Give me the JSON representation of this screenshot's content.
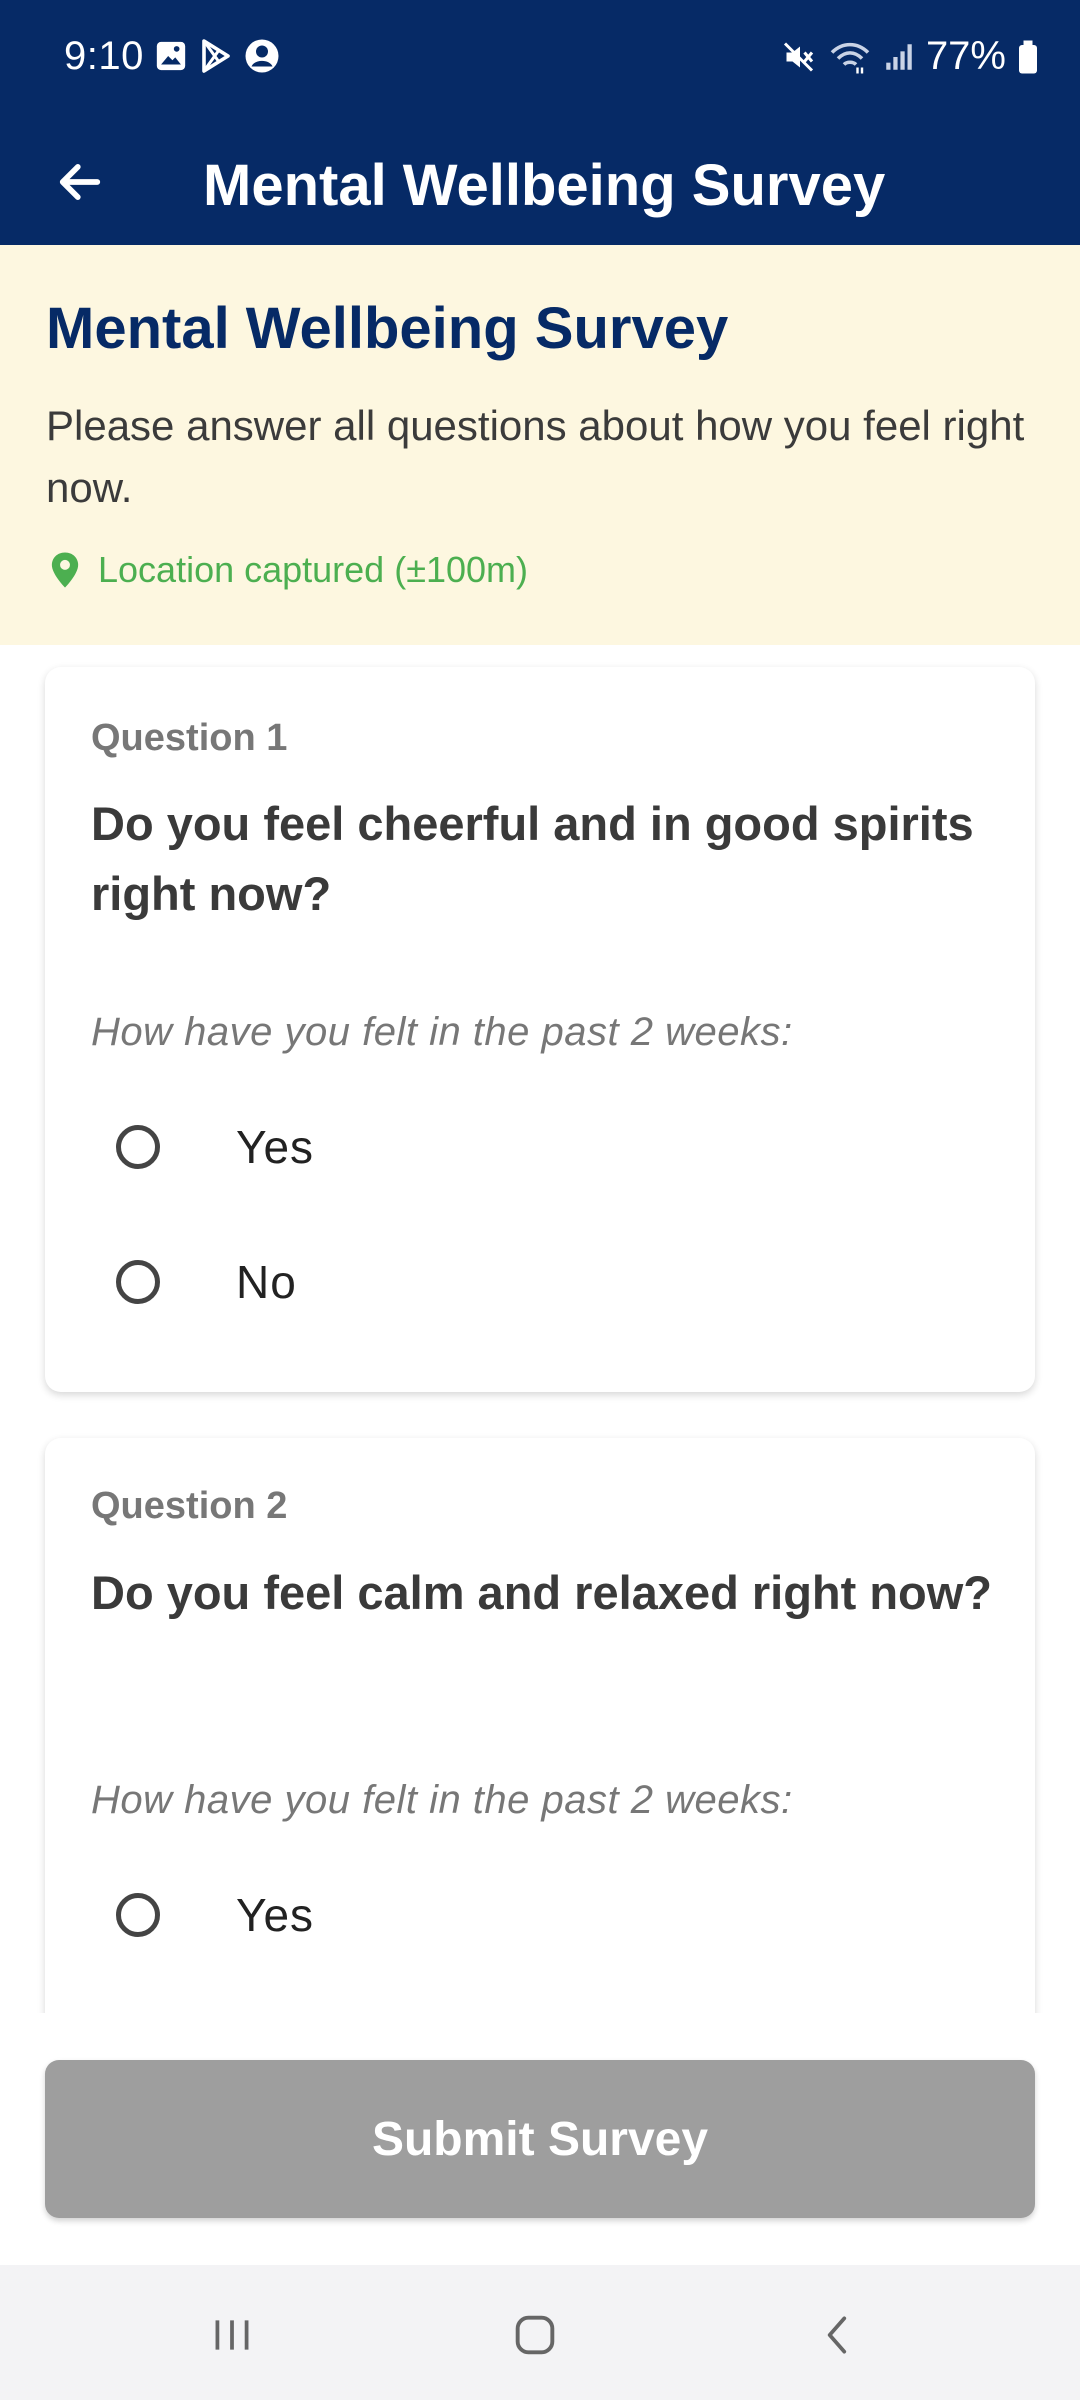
{
  "status_bar": {
    "time": "9:10",
    "battery": "77%",
    "left_icons": [
      "gallery-icon",
      "play-store-icon",
      "account-icon"
    ],
    "right_icons": [
      "mute-icon",
      "wifi-icon",
      "signal-icon",
      "battery-icon"
    ]
  },
  "app_bar": {
    "title": "Mental Wellbeing Survey",
    "back_icon": "arrow-left-icon",
    "background": "#062a66"
  },
  "banner": {
    "title": "Mental Wellbeing Survey",
    "description": "Please answer all questions about how you feel right now.",
    "location_text": "Location captured (±100m)",
    "location_icon": "location-pin-icon",
    "background": "#fdf7e0",
    "location_color": "#4caf50"
  },
  "questions": [
    {
      "number_label": "Question 1",
      "text": "Do you feel cheerful and in good spirits right now?",
      "hint": "How have you felt in the past 2 weeks:",
      "options": [
        "Yes",
        "No"
      ]
    },
    {
      "number_label": "Question 2",
      "text": "Do you feel calm and relaxed right now?",
      "hint": "How have you felt in the past 2 weeks:",
      "options": [
        "Yes"
      ]
    }
  ],
  "submit": {
    "label": "Submit Survey",
    "state": "disabled",
    "color": "#9e9e9e"
  },
  "nav_bar": {
    "icons": [
      "recent-apps-icon",
      "home-icon",
      "back-icon"
    ]
  }
}
